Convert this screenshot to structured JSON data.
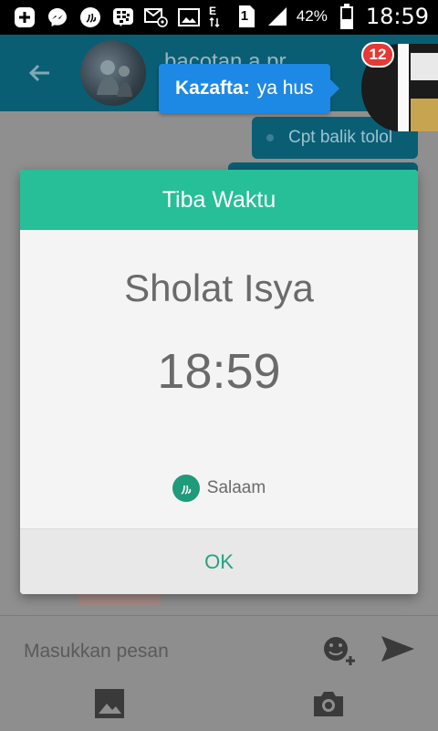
{
  "status_bar": {
    "battery_percent": "42%",
    "time": "18:59",
    "sim_slot": "1",
    "left_icons": [
      "plus-icon",
      "messenger-icon",
      "salaam-icon",
      "bbm-icon",
      "email-icon",
      "image-icon"
    ]
  },
  "chat": {
    "title": "bacotan a pr...",
    "messages": [
      {
        "direction": "out",
        "text": "Cpt balik tolol"
      }
    ],
    "input_placeholder": "Masukkan pesan"
  },
  "notification": {
    "badge_count": "12",
    "sender": "Kazafta:",
    "message": "ya hus"
  },
  "dialog": {
    "title": "Tiba Waktu",
    "prayer_name": "Sholat Isya",
    "time": "18:59",
    "brand": "Salaam",
    "ok_label": "OK"
  },
  "colors": {
    "dialog_header": "#26bf97",
    "ok_text": "#26a283",
    "appbar": "#0a5e74",
    "toast": "#1e88e5",
    "badge": "#e53935"
  }
}
